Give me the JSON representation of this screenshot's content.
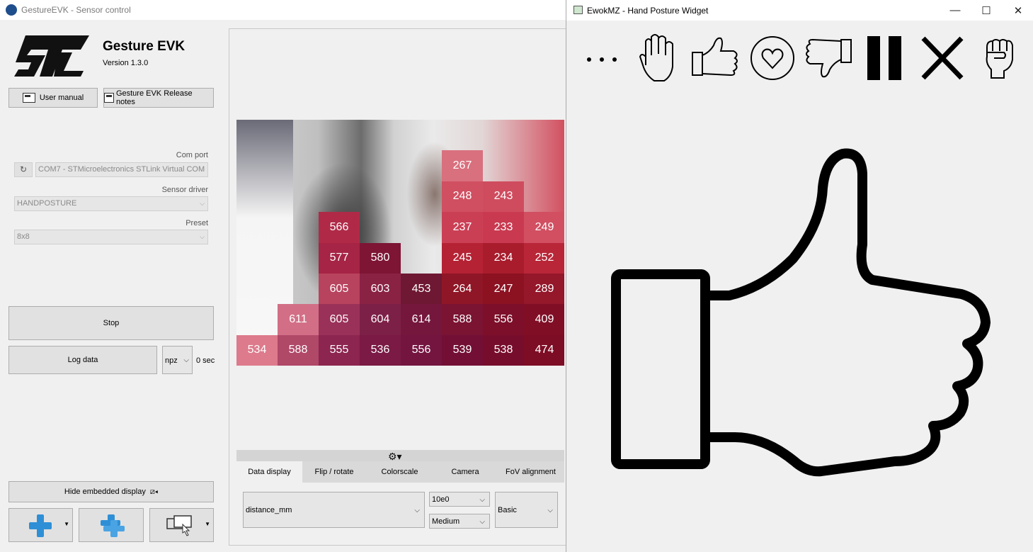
{
  "main_window": {
    "title": "GestureEVK - Sensor control"
  },
  "app": {
    "name": "Gesture EVK",
    "version": "Version 1.3.0"
  },
  "buttons": {
    "user_manual": "User manual",
    "release_notes": "Gesture EVK Release notes",
    "stop": "Stop",
    "log_data": "Log data",
    "hide_display": "Hide embedded display"
  },
  "settings": {
    "com_port_label": "Com port",
    "com_port_value": "COM7 - STMicroelectronics STLink Virtual COM",
    "sensor_driver_label": "Sensor driver",
    "sensor_driver_value": "HANDPOSTURE",
    "preset_label": "Preset",
    "preset_value": "8x8"
  },
  "logging": {
    "format": "npz",
    "duration": "0 sec"
  },
  "heatmap": {
    "cells": [
      {
        "r": 0,
        "c": 5,
        "v": "267",
        "color": "#d9707e"
      },
      {
        "r": 1,
        "c": 5,
        "v": "248",
        "color": "#d04f61"
      },
      {
        "r": 1,
        "c": 6,
        "v": "243",
        "color": "#cf4c5e"
      },
      {
        "r": 2,
        "c": 2,
        "v": "566",
        "color": "#b02a48"
      },
      {
        "r": 2,
        "c": 5,
        "v": "237",
        "color": "#cb3f55"
      },
      {
        "r": 2,
        "c": 6,
        "v": "233",
        "color": "#c93a50"
      },
      {
        "r": 2,
        "c": 7,
        "v": "249",
        "color": "#d14f61"
      },
      {
        "r": 3,
        "c": 2,
        "v": "577",
        "color": "#a62445"
      },
      {
        "r": 3,
        "c": 3,
        "v": "580",
        "color": "#7e1535"
      },
      {
        "r": 3,
        "c": 5,
        "v": "245",
        "color": "#b52234"
      },
      {
        "r": 3,
        "c": 6,
        "v": "234",
        "color": "#a81c2c"
      },
      {
        "r": 3,
        "c": 7,
        "v": "252",
        "color": "#b82638"
      },
      {
        "r": 4,
        "c": 2,
        "v": "605",
        "color": "#b8435e"
      },
      {
        "r": 4,
        "c": 3,
        "v": "603",
        "color": "#8a2244"
      },
      {
        "r": 4,
        "c": 4,
        "v": "453",
        "color": "#6e1833"
      },
      {
        "r": 4,
        "c": 5,
        "v": "264",
        "color": "#8f1626"
      },
      {
        "r": 4,
        "c": 6,
        "v": "247",
        "color": "#8c1222"
      },
      {
        "r": 4,
        "c": 7,
        "v": "289",
        "color": "#94172a"
      },
      {
        "r": 5,
        "c": 1,
        "v": "611",
        "color": "#d26f86"
      },
      {
        "r": 5,
        "c": 2,
        "v": "605",
        "color": "#9a3158"
      },
      {
        "r": 5,
        "c": 3,
        "v": "604",
        "color": "#7d2047"
      },
      {
        "r": 5,
        "c": 4,
        "v": "614",
        "color": "#75173c"
      },
      {
        "r": 5,
        "c": 5,
        "v": "588",
        "color": "#7b1333"
      },
      {
        "r": 5,
        "c": 6,
        "v": "556",
        "color": "#7d0f2a"
      },
      {
        "r": 5,
        "c": 7,
        "v": "409",
        "color": "#800f26"
      },
      {
        "r": 6,
        "c": 0,
        "v": "534",
        "color": "#dd7a8c"
      },
      {
        "r": 6,
        "c": 1,
        "v": "588",
        "color": "#b04868"
      },
      {
        "r": 6,
        "c": 2,
        "v": "555",
        "color": "#8c2550"
      },
      {
        "r": 6,
        "c": 3,
        "v": "536",
        "color": "#7a1a45"
      },
      {
        "r": 6,
        "c": 4,
        "v": "556",
        "color": "#741540"
      },
      {
        "r": 6,
        "c": 5,
        "v": "539",
        "color": "#730f35"
      },
      {
        "r": 6,
        "c": 6,
        "v": "538",
        "color": "#770d2c"
      },
      {
        "r": 6,
        "c": 7,
        "v": "474",
        "color": "#7d0c25"
      }
    ]
  },
  "tabs": [
    "Data display",
    "Flip / rotate",
    "Colorscale",
    "Camera",
    "FoV alignment"
  ],
  "display_options": {
    "data_field": "distance_mm",
    "scale": "10e0",
    "level": "Medium",
    "mode": "Basic"
  },
  "widget": {
    "title": "EwokMZ - Hand Posture Widget",
    "gesture_icons": [
      "dots-icon",
      "open-palm-icon",
      "thumbs-up-icon",
      "heart-icon",
      "thumbs-down-icon",
      "pause-icon",
      "cross-icon",
      "fist-icon"
    ],
    "detected_posture": "thumbs-up-icon"
  },
  "colors": {
    "accent_blue": "#2f8fd6"
  }
}
